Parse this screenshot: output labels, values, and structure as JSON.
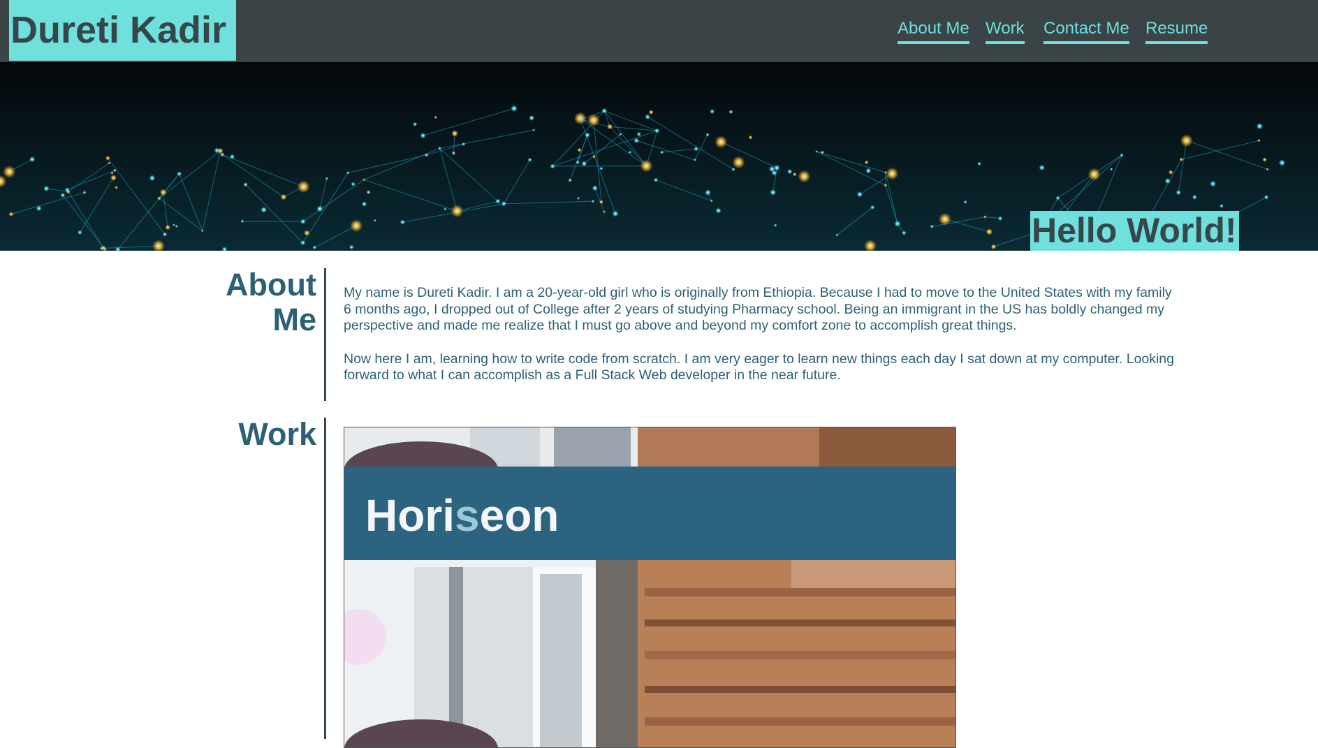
{
  "header": {
    "brand": "Dureti Kadir",
    "nav": [
      "About Me",
      "Work",
      "Contact Me",
      "Resume"
    ]
  },
  "hero": {
    "greeting": "Hello World!"
  },
  "about": {
    "title": "About Me",
    "paragraphs": [
      "My name is Dureti Kadir. I am a 20-year-old girl who is originally from Ethiopia. Because I had to move to the United States with my family 6 months ago, I dropped out of College after 2 years of studying Pharmacy school. Being an immigrant in the US has boldly changed my perspective and made me realize that I must go above and beyond my comfort zone to accomplish great things.",
      "Now here I am, learning how to write code from scratch. I am very eager to learn new things each day I sat down at my computer. Looking forward to what I can accomplish as a Full Stack Web developer in the near future."
    ]
  },
  "work": {
    "title": "Work",
    "project": {
      "name_part1": "Hori",
      "name_part2": "s",
      "name_part3": "eon"
    }
  },
  "colors": {
    "header_bg": "#3a4345",
    "accent": "#6fe0dc",
    "heading_text": "#36474c",
    "section_text": "#2e6075",
    "banner_blue": "#2b6380"
  }
}
